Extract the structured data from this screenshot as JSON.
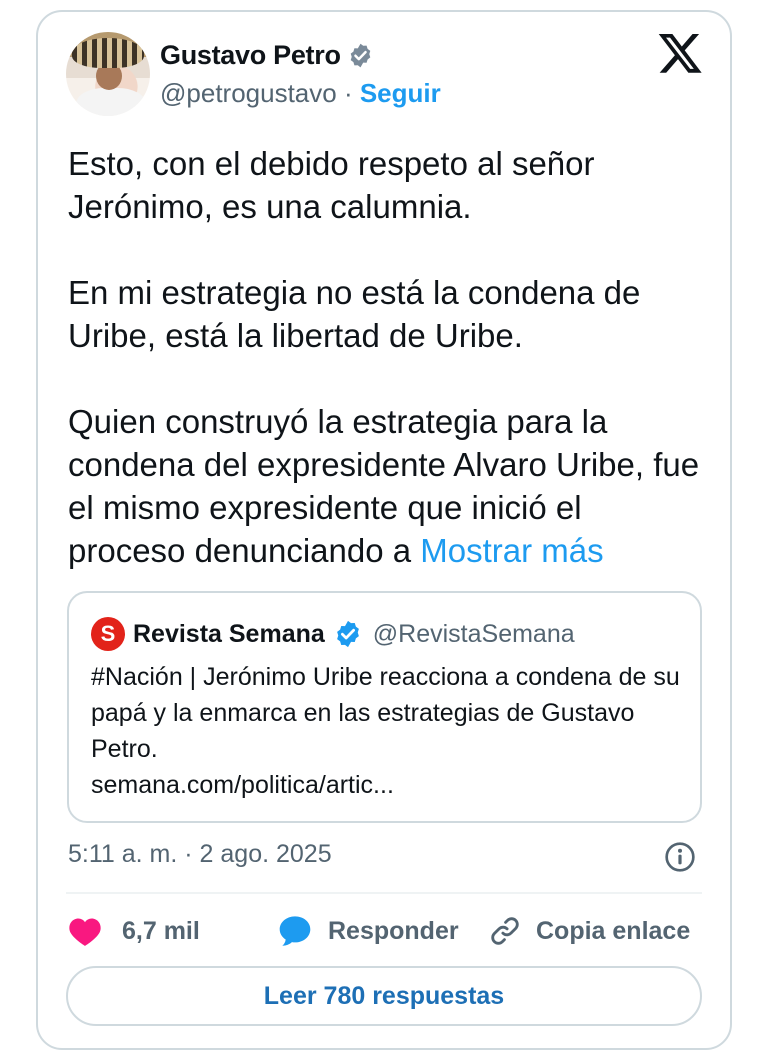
{
  "author": {
    "name": "Gustavo Petro",
    "handle": "@petrogustavo",
    "separator": " · ",
    "follow_label": "Seguir"
  },
  "tweet": {
    "paragraphs": [
      "Esto, con el debido respeto al señor Jerónimo, es una calumnia.",
      "En mi estrategia no está la condena de Uribe, está la libertad de Uribe.",
      "Quien construyó la estrategia para la condena del expresidente Alvaro Uribe, fue el mismo expresidente que inició el proceso denunciando a"
    ],
    "show_more": "Mostrar más"
  },
  "quote": {
    "logo_letter": "S",
    "name": "Revista Semana",
    "handle": "@RevistaSemana",
    "body": "#Nación | Jerónimo Uribe reacciona a condena de su papá y la enmarca en las estrategias de Gustavo Petro.",
    "link": "semana.com/politica/artic..."
  },
  "timestamp": "5:11 a. m. · 2 ago. 2025",
  "actions": {
    "likes": "6,7 mil",
    "reply_label": "Responder",
    "copy_label": "Copia enlace"
  },
  "replies_button": "Leer 780 respuestas",
  "colors": {
    "accent": "#1d9bf0",
    "like": "#f91880",
    "semana_red": "#e2231a",
    "muted": "#536471"
  },
  "icons": [
    "verified-badge-icon",
    "x-logo-icon",
    "info-icon",
    "heart-icon",
    "reply-bubble-icon",
    "link-icon"
  ]
}
